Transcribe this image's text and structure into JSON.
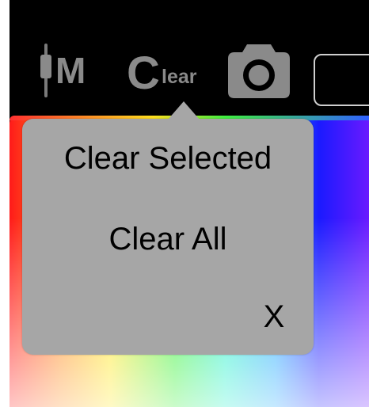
{
  "toolbar": {
    "mode_label": "M",
    "clear_big_letter": "C",
    "clear_small_text": "lear",
    "camera_icon": "camera-icon",
    "slider_icon": "slider-icon",
    "text_box_value": ""
  },
  "popover": {
    "clear_selected_label": "Clear Selected",
    "clear_all_label": "Clear All",
    "close_label": "X"
  },
  "colors": {
    "toolbar_bg": "#000000",
    "icon_gray": "#8a8a8a",
    "popover_bg": "#a6a6a6",
    "text": "#000000"
  }
}
